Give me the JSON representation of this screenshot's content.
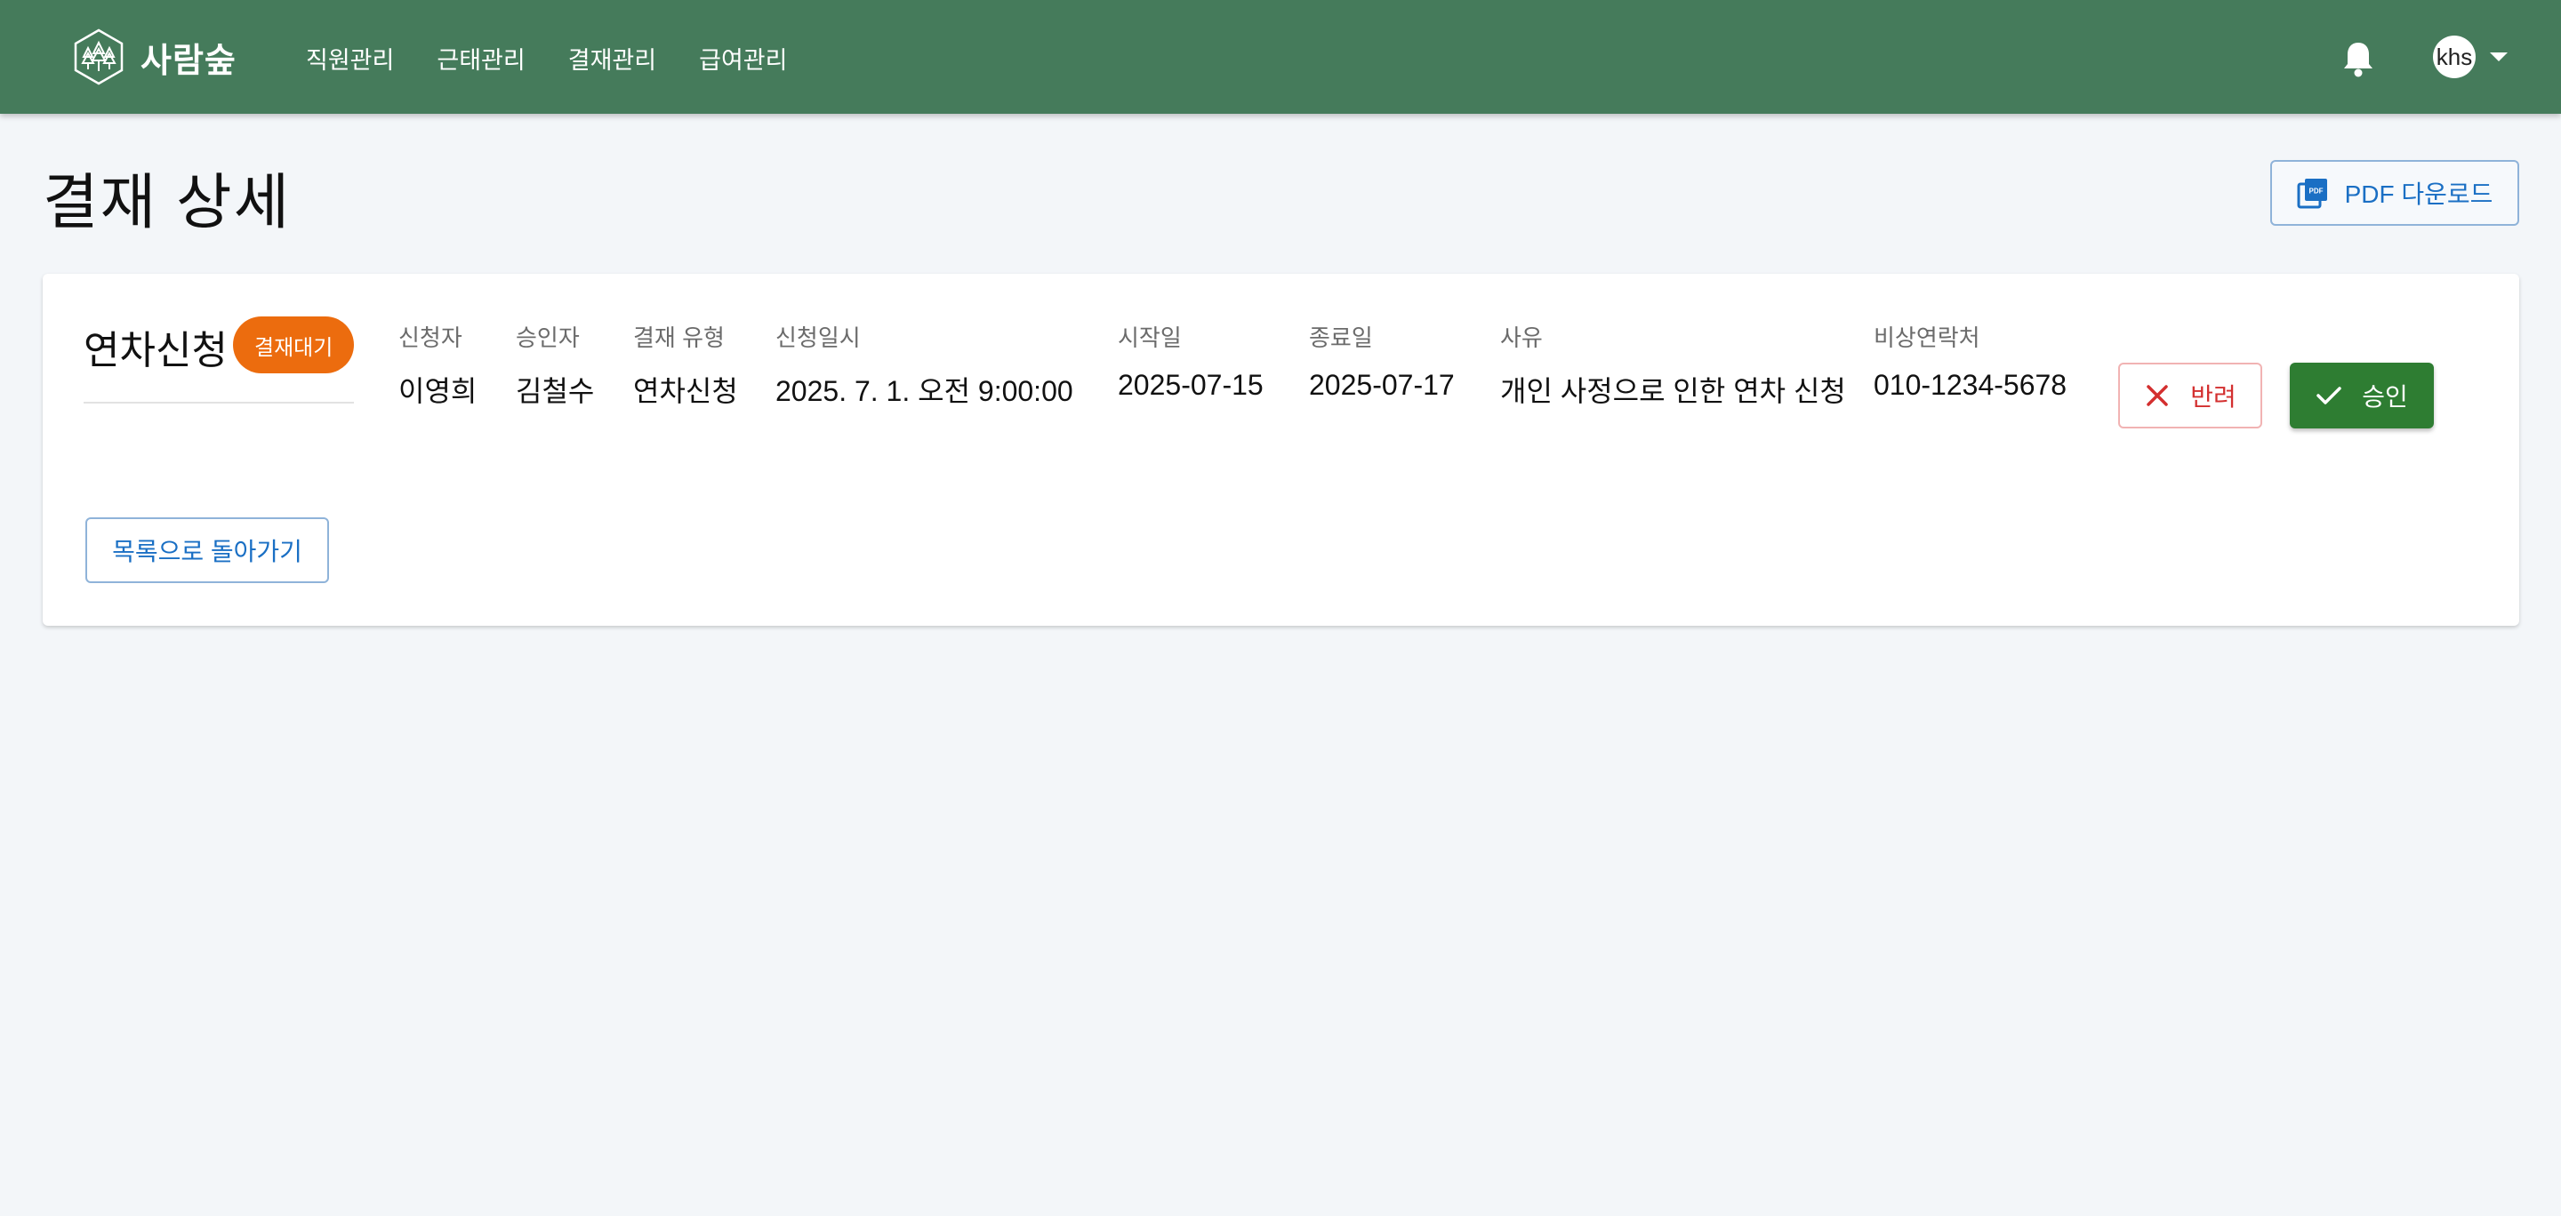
{
  "header": {
    "brand_name": "사람숲",
    "nav": [
      {
        "label": "직원관리"
      },
      {
        "label": "근태관리"
      },
      {
        "label": "결재관리"
      },
      {
        "label": "급여관리"
      }
    ],
    "user_initials": "khs"
  },
  "page": {
    "title": "결재 상세",
    "pdf_button_label": "PDF 다운로드"
  },
  "approval": {
    "doc_type": "연차신청",
    "status": "결재대기",
    "fields": [
      {
        "label": "신청자",
        "value": "이영희"
      },
      {
        "label": "승인자",
        "value": "김철수"
      },
      {
        "label": "결재 유형",
        "value": "연차신청"
      },
      {
        "label": "신청일시",
        "value": "2025. 7. 1. 오전 9:00:00"
      },
      {
        "label": "시작일",
        "value": "2025-07-15"
      },
      {
        "label": "종료일",
        "value": "2025-07-17"
      },
      {
        "label": "사유",
        "value": "개인 사정으로 인한 연차 신청"
      },
      {
        "label": "비상연락처",
        "value": "010-1234-5678"
      }
    ],
    "reject_label": "반려",
    "approve_label": "승인",
    "back_label": "목록으로 돌아가기"
  },
  "icons": {
    "brand_logo": "tree-hexagon-icon",
    "notification": "bell-icon",
    "pdf": "pdf-file-icon",
    "reject": "close-icon",
    "approve": "check-icon",
    "user_menu": "caret-down-icon"
  },
  "colors": {
    "header_bg": "#457b5b",
    "status_badge": "#ec6c0e",
    "approve": "#2e7d32",
    "reject": "#d32f2f",
    "link_blue": "#1a6fc4"
  }
}
